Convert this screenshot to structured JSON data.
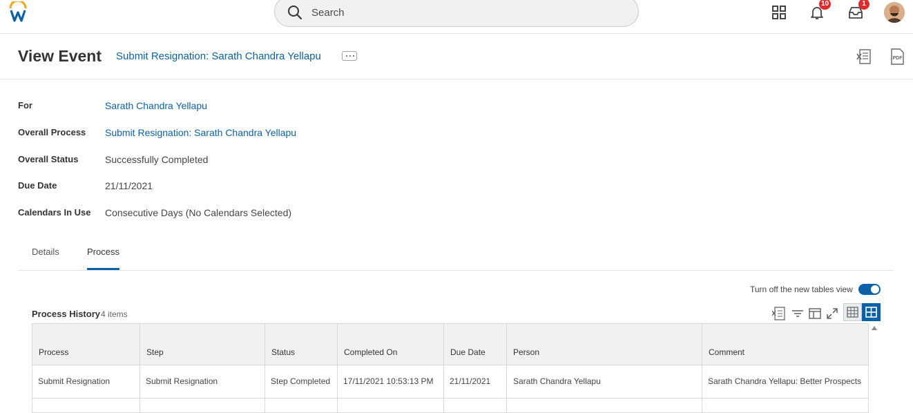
{
  "topbar": {
    "search_placeholder": "Search",
    "notifications_count": "10",
    "inbox_count": "1"
  },
  "header": {
    "title": "View Event",
    "event_link": "Submit Resignation: Sarath Chandra Yellapu"
  },
  "fields": [
    {
      "label": "For",
      "value": "Sarath Chandra Yellapu",
      "is_link": true
    },
    {
      "label": "Overall Process",
      "value": "Submit Resignation: Sarath Chandra Yellapu",
      "is_link": true
    },
    {
      "label": "Overall Status",
      "value": "Successfully Completed",
      "is_link": false
    },
    {
      "label": "Due Date",
      "value": "21/11/2021",
      "is_link": false
    },
    {
      "label": "Calendars In Use",
      "value": "Consecutive Days (No Calendars Selected)",
      "is_link": false
    }
  ],
  "tabs": [
    {
      "label": "Details",
      "active": false
    },
    {
      "label": "Process",
      "active": true
    }
  ],
  "table_toggle_label": "Turn off the new tables view",
  "process_history": {
    "title": "Process History",
    "count": "4 items",
    "columns": [
      "Process",
      "Step",
      "Status",
      "Completed On",
      "Due Date",
      "Person",
      "Comment"
    ],
    "rows": [
      {
        "process": "Submit Resignation",
        "step": "Submit Resignation",
        "status": "Step Completed",
        "completed_on": "17/11/2021 10:53:13 PM",
        "due_date": "21/11/2021",
        "person": "Sarath Chandra Yellapu",
        "comment": "Sarath Chandra Yellapu: Better Prospects"
      }
    ]
  },
  "colors": {
    "link": "#0b61a8",
    "badge": "#de2b2b",
    "logo_orange": "#f5a623",
    "logo_blue": "#0b61a8"
  }
}
